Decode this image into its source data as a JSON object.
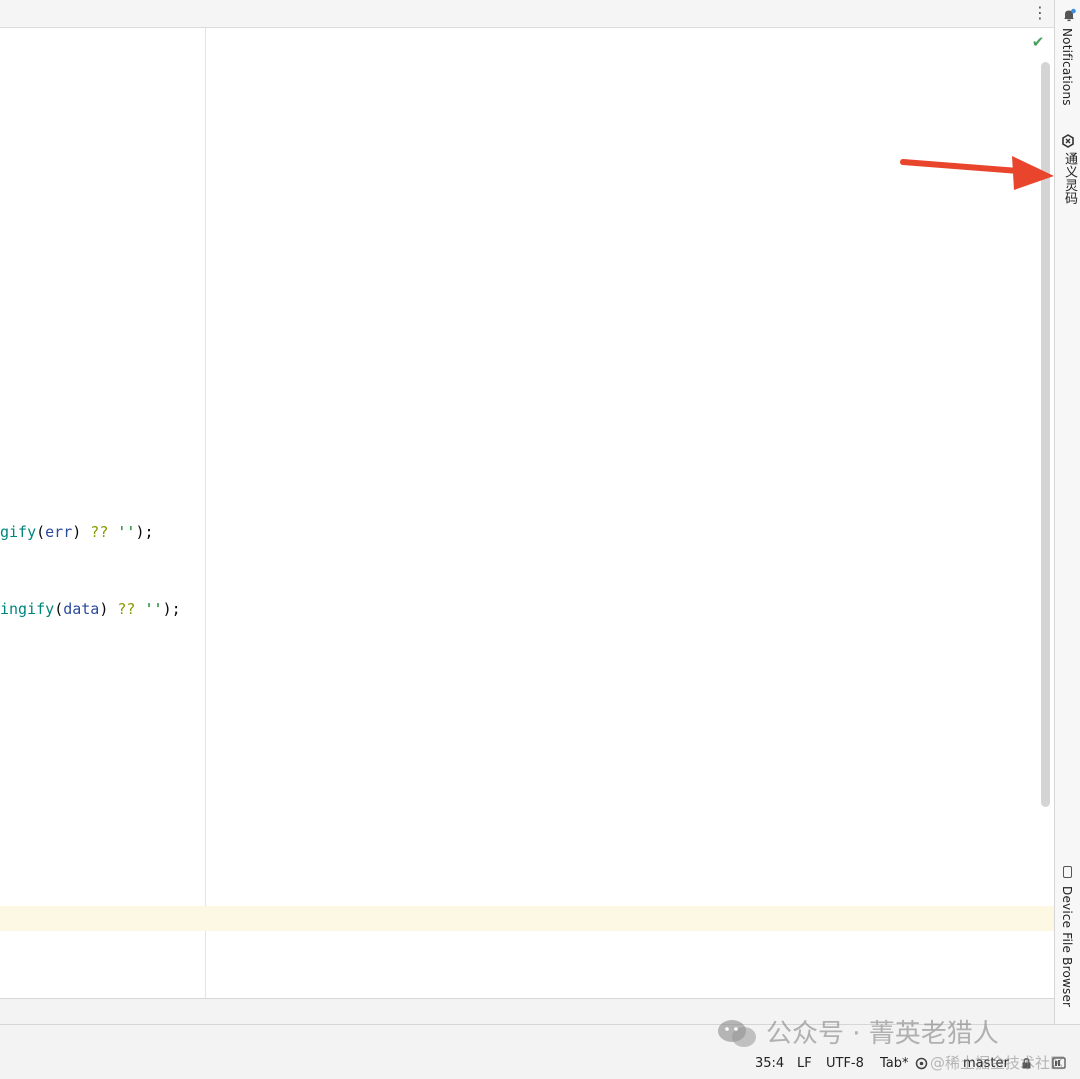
{
  "sidebar": {
    "notifications_label": "Notifications",
    "tongyi_label": "通义灵码",
    "device_file_browser_label": "Device File Browser"
  },
  "editor": {
    "line1": {
      "fn": "gify",
      "open": "(",
      "arg": "err",
      "close": ")",
      "op": " ?? ",
      "str": "''",
      "end": ");"
    },
    "line2": {
      "fn": "ingify",
      "open": "(",
      "arg": "data",
      "close": ")",
      "op": " ?? ",
      "str": "''",
      "end": ");"
    }
  },
  "status": {
    "position": "35:4",
    "line_ending": "LF",
    "encoding": "UTF-8",
    "indent": "Tab*",
    "branch": "master"
  },
  "watermark": {
    "text": "公众号 · 菁英老猎人",
    "subtext": "@稀土掘金技术社区"
  },
  "colors": {
    "arrow": "#e8452c",
    "check": "#4aa15a",
    "current_line": "#fdf8e4"
  }
}
